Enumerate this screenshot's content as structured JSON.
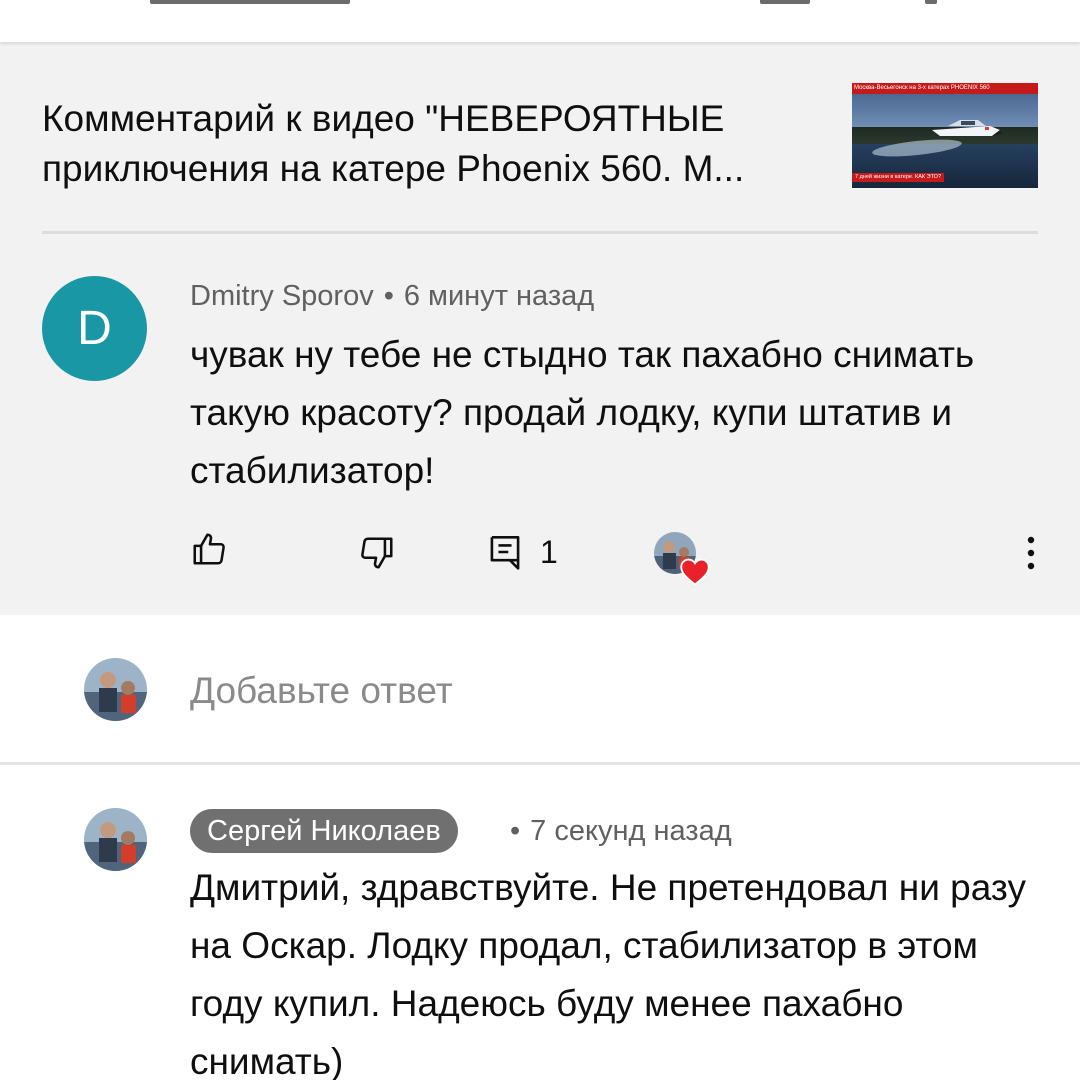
{
  "video_context": {
    "title": "Комментарий к видео \"НЕВЕРОЯТНЫЕ приключения на катере Phoenix 560. М...",
    "thumbnail": {
      "top_caption": "Москва-Весьегонск на 3-х катерах PHOENIX 560",
      "bottom_caption": "7 дней жизни в катере. КАК ЭТО?"
    }
  },
  "comment": {
    "avatar_letter": "D",
    "avatar_color": "#1a97a4",
    "author": "Dmitry Sporov",
    "separator": "•",
    "time": "6 минут назад",
    "text": "чувак ну тебе не стыдно так пахабно снимать такую красоту? продай лодку, купи штатив и стабилизатор!",
    "actions": {
      "like_icon": "thumbs-up-icon",
      "dislike_icon": "thumbs-down-icon",
      "reply_icon": "reply-comment-icon",
      "reply_count": "1",
      "creator_heart_icon": "heart-icon",
      "heart_color": "#e8212b",
      "more_icon": "more-vertical-icon"
    }
  },
  "reply_input": {
    "placeholder": "Добавьте ответ"
  },
  "reply": {
    "author": "Сергей Николаев",
    "separator": "•",
    "time": "7 секунд назад",
    "text": "Дмитрий,  здравствуйте.  Не претендовал ни разу на Оскар. Лодку продал, стабилизатор в этом году купил. Надеюсь буду менее пахабно снимать)"
  }
}
